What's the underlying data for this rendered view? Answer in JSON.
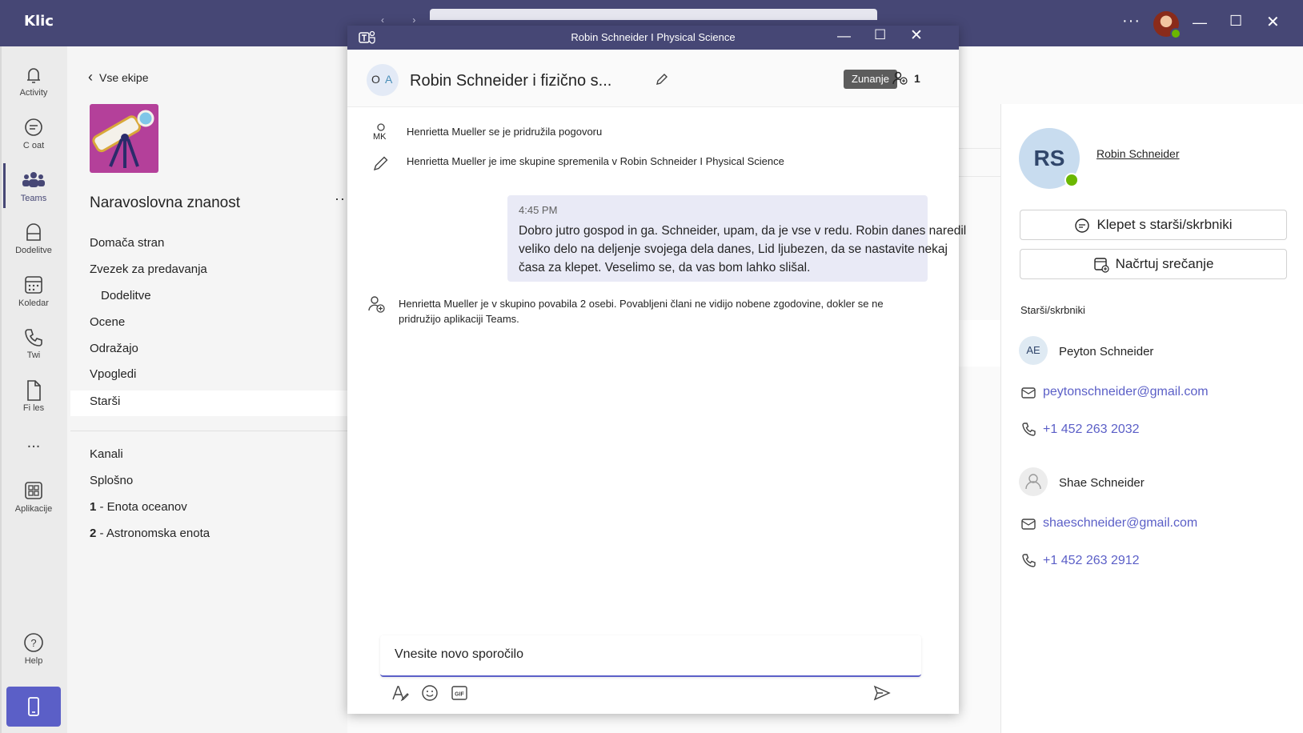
{
  "app": {
    "logo": "Klic"
  },
  "rail": [
    {
      "label": "Activity",
      "icon": "bell-icon"
    },
    {
      "label": "C oat",
      "icon": "chat-icon"
    },
    {
      "label": "Teams",
      "icon": "teams-icon"
    },
    {
      "label": "Dodelitve",
      "icon": "assignments-icon"
    },
    {
      "label": "Koledar",
      "icon": "calendar-icon"
    },
    {
      "label": "Twi",
      "icon": "phone-icon"
    },
    {
      "label": "Fi les",
      "icon": "file-icon"
    },
    {
      "label": "...",
      "icon": "more-icon"
    },
    {
      "label": "Aplikacije",
      "icon": "apps-icon"
    },
    {
      "label": "Help",
      "icon": "help-icon"
    }
  ],
  "team": {
    "back_label": "Vse ekipe",
    "name": "Naravoslovna znanost",
    "more": "···",
    "nav": [
      "Domača stran",
      "Zvezek za predavanja",
      "Dodelitve",
      "Ocene",
      "Odražajo",
      "Vpogledi",
      "Starši"
    ],
    "channels_header": "Kanali",
    "channels": [
      "Splošno",
      "- Enota oceanov",
      "- Astronomska enota"
    ],
    "channel_numbers": [
      "1",
      "2"
    ]
  },
  "popup": {
    "window_title": "Robin Schneider I Physical Science",
    "chat_title": "Robin Schneider i fizično s...",
    "avatar_initials": [
      "O",
      "A"
    ],
    "external_badge": "Zunanje",
    "participant_count": "1",
    "sys_messages": [
      {
        "icon": "person-icon",
        "icon_label": "MK",
        "text": "Henrietta Mueller se je pridružila pogovoru"
      },
      {
        "icon": "pencil-icon",
        "text": "Henrietta Mueller je ime skupine spremenila v Robin Schneider I Physical Science"
      },
      {
        "icon": "add-person-icon",
        "text": "Henrietta Mueller je v skupino povabila 2 osebi. Povabljeni člani ne vidijo nobene zgodovine, dokler se ne pridružijo aplikaciji Teams."
      }
    ],
    "message": {
      "time": "4:45 PM",
      "text": "Dobro jutro gospod in ga. Schneider, upam, da je vse v redu. Robin danes naredil veliko delo na deljenje svojega dela danes, Lid ljubezen, da se nastavite nekaj časa za klepet. Veselimo se, da vas bom lahko slišal."
    },
    "compose_placeholder": "Vnesite novo sporočilo"
  },
  "profile": {
    "initials": "RS",
    "name": "Robin Schneider",
    "chat_button": "Klepet s starši/skrbniki",
    "meeting_button": "Načrtuj srečanje",
    "section_label": "Starši/skrbniki",
    "contacts": [
      {
        "initials": "AE",
        "name": "Peyton Schneider",
        "email": "peytonschneider@gmail.com",
        "phone": "+1 452 263 2032"
      },
      {
        "initials": "",
        "name": "Shae Schneider",
        "email": "shaeschneider@gmail.com",
        "phone": "+1 452 263 2912"
      }
    ]
  },
  "colors": {
    "brand": "#464775",
    "accent": "#5b5fc7",
    "online": "#6bb700"
  }
}
